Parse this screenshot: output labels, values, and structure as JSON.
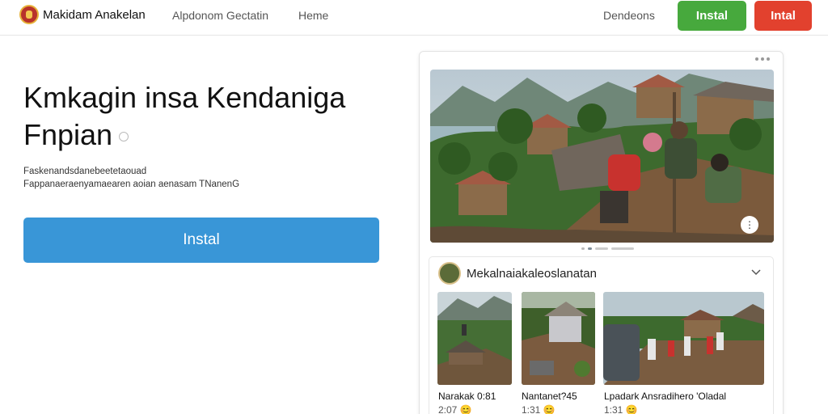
{
  "header": {
    "brand": "Makidam Anakelan",
    "nav": [
      "Alpdonom Gectatin",
      "Heme",
      "Dendeons"
    ],
    "install_green": "Instal",
    "install_red": "Intal"
  },
  "hero": {
    "title_line1": "Kmkagin insa Kendaniga",
    "title_line2": "Fnpian",
    "desc_line1": "Faskenandsdanebeetetaouad",
    "desc_line2": "Fappanaeraenyamaearen aoian aenasam TNanenG",
    "install_label": "Instal"
  },
  "card": {
    "section_title": "Mekalnaiakaleoslanatan",
    "thumbnails": [
      {
        "label": "Narakak 0:81",
        "meta": "2:07",
        "emoji": "😊"
      },
      {
        "label": "Nantanet?45",
        "meta": "1:31",
        "emoji": "😊"
      },
      {
        "label": "Lpadark Ansradihero 'Oladal",
        "meta": "1:31",
        "emoji": "😊"
      }
    ],
    "pager_dots": 4,
    "active_dot": 1
  },
  "icons": {
    "logo": "crest-logo-icon",
    "menu": "more-dots-icon",
    "chevron": "chevron-down-icon",
    "photo_more": "more-dots-icon"
  },
  "colors": {
    "install_blue": "#3996d7",
    "install_green": "#47a93d",
    "install_red": "#e2412e"
  }
}
